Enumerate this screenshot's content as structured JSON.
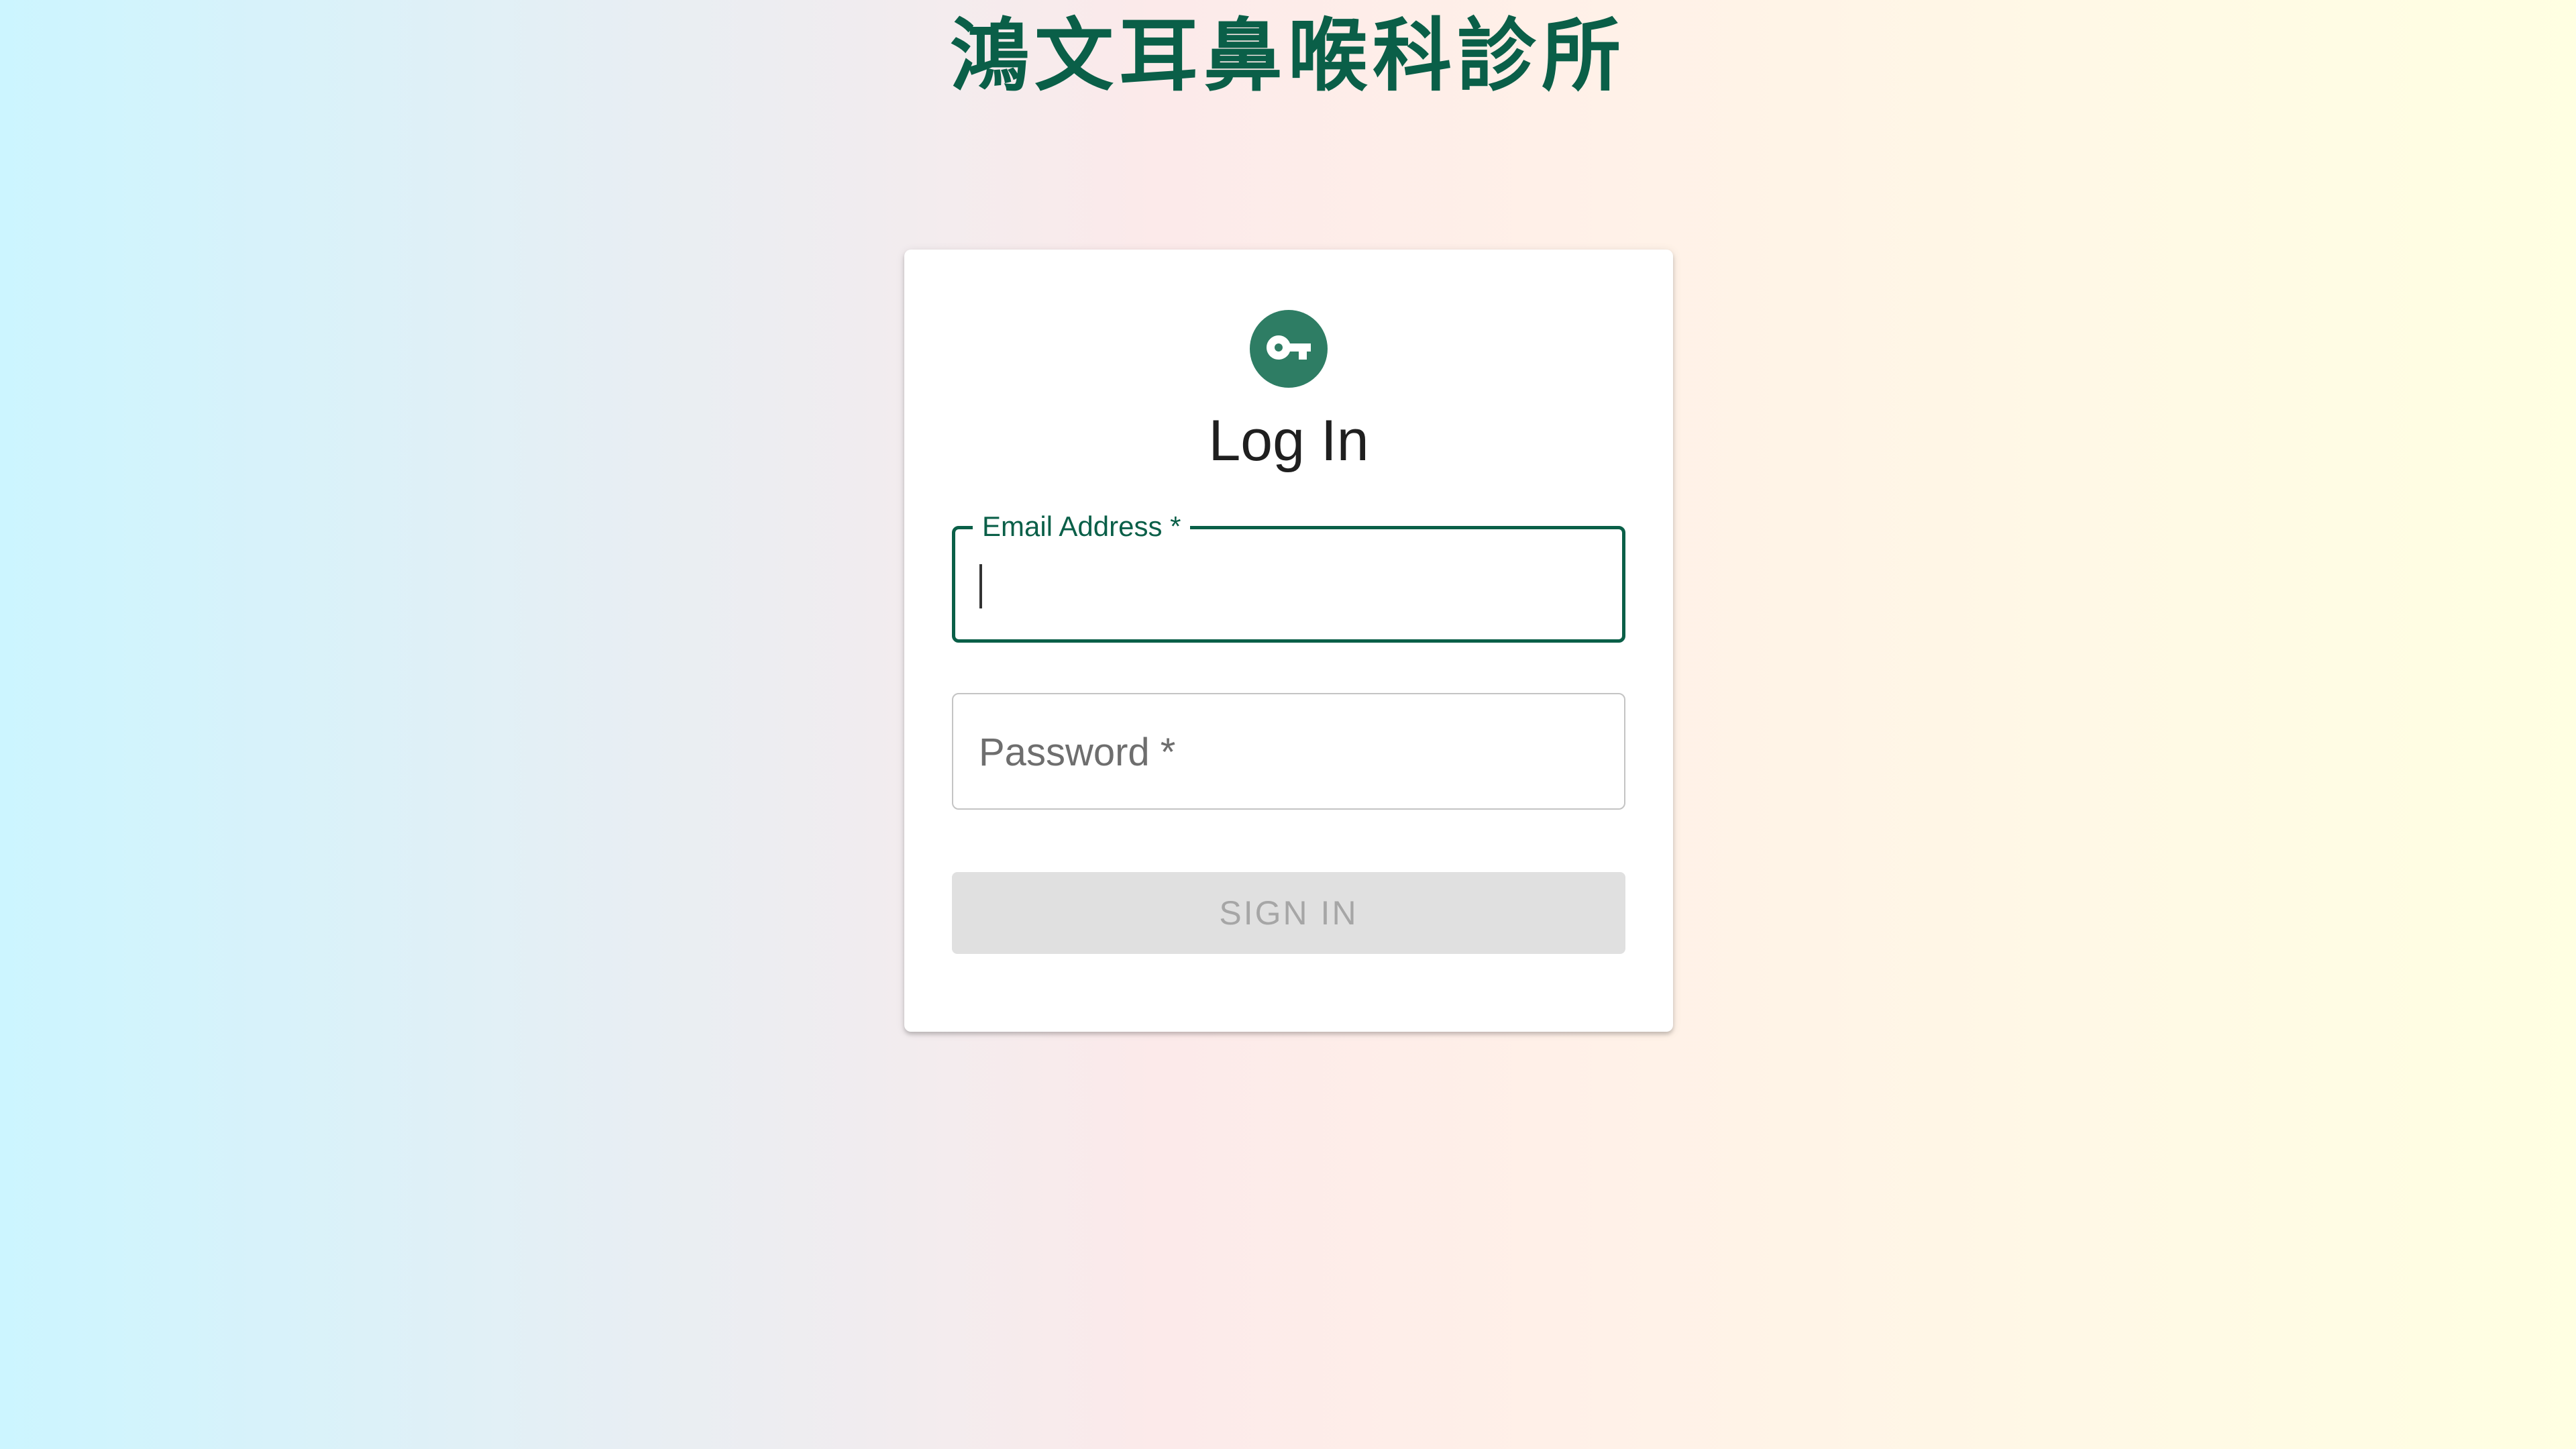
{
  "header": {
    "clinic_name": "鴻文耳鼻喉科診所"
  },
  "login_card": {
    "icon": "key-icon",
    "title": "Log In",
    "email": {
      "label": "Email Address *",
      "value": "",
      "state": "focused"
    },
    "password": {
      "placeholder": "Password *",
      "value": ""
    },
    "submit_label": "SIGN IN",
    "submit_state": "disabled"
  },
  "colors": {
    "brand_green": "#0a5f48",
    "avatar_green": "#2e7d64",
    "disabled_button_bg": "#e0e0e0",
    "disabled_button_text": "#a6a6a6"
  }
}
